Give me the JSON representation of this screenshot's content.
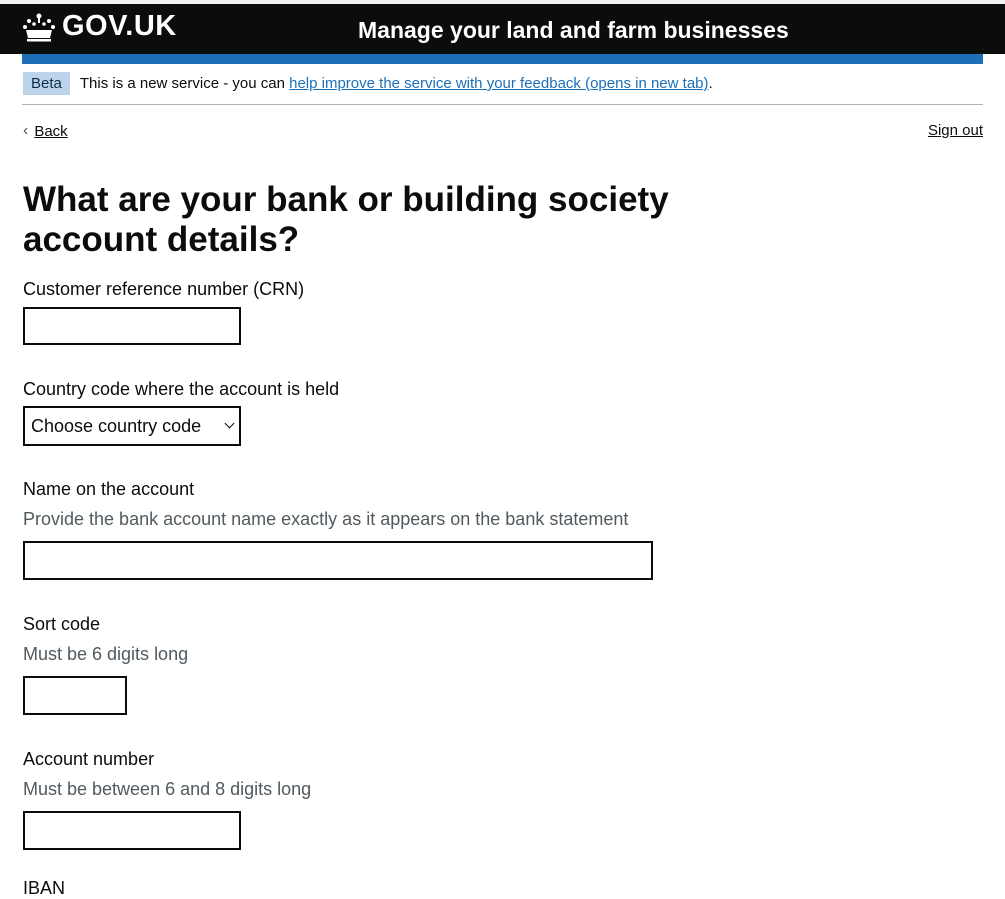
{
  "header": {
    "logo_text": "GOV.UK",
    "service_name": "Manage your land and farm businesses"
  },
  "phase_banner": {
    "tag": "Beta",
    "text": "This is a new service - you can ",
    "link": "help improve the service with your feedback (opens in new tab)",
    "suffix": "."
  },
  "nav": {
    "back": "Back",
    "sign_out": "Sign out"
  },
  "page": {
    "title": "What are your bank or building society account details?"
  },
  "form": {
    "crn_label": "Customer reference number (CRN)",
    "crn_value": "",
    "country_label": "Country code where the account is held",
    "country_selected": "Choose country code",
    "name_label": "Name on the account",
    "name_hint": "Provide the bank account name exactly as it appears on the bank statement",
    "name_value": "",
    "sort_label": "Sort code",
    "sort_hint": "Must be 6 digits long",
    "sort_value": "",
    "account_label": "Account number",
    "account_hint": "Must be between 6 and 8 digits long",
    "account_value": "",
    "iban_label": "IBAN"
  },
  "colors": {
    "header_bg": "#0b0c0c",
    "blue_bar": "#1d70b8",
    "link": "#1d70b8",
    "beta_tag_bg": "#bbd4ea",
    "hint_text": "#505a5f"
  },
  "icons": [
    "crown-icon",
    "chevron-left-icon",
    "chevron-down-icon"
  ]
}
